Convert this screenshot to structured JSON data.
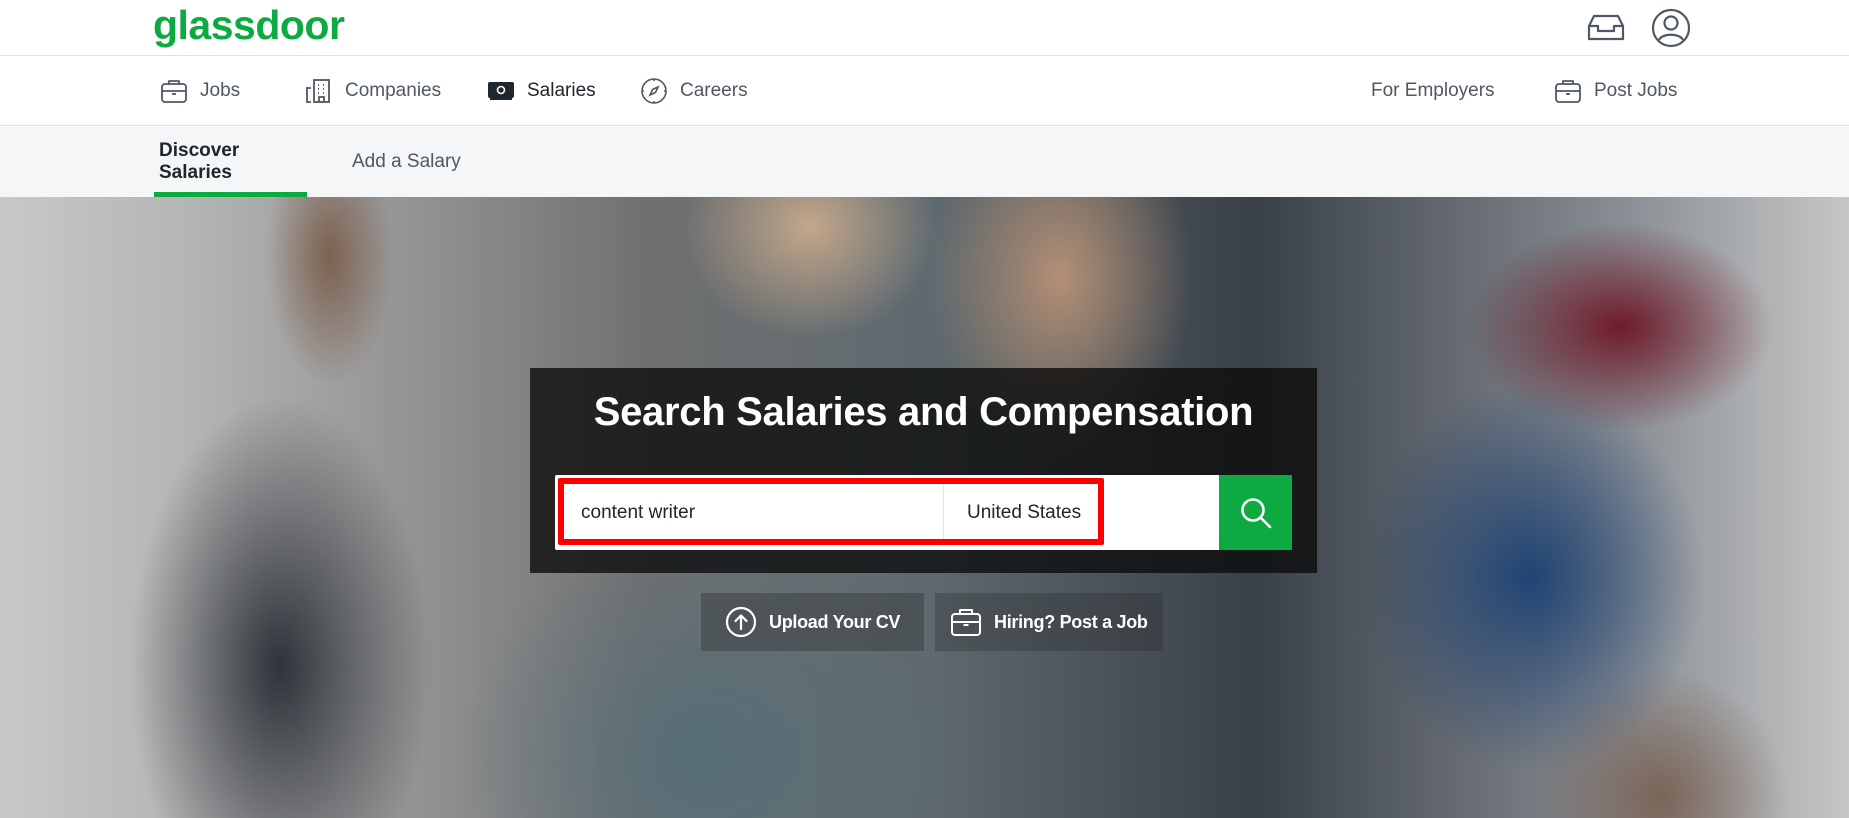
{
  "brand": {
    "logo_text": "glassdoor",
    "accent_color": "#0caa41"
  },
  "header": {
    "icons": [
      {
        "name": "inbox-icon"
      },
      {
        "name": "profile-icon"
      }
    ]
  },
  "nav": {
    "items": [
      {
        "label": "Jobs",
        "icon": "briefcase-icon",
        "active": false
      },
      {
        "label": "Companies",
        "icon": "building-icon",
        "active": false
      },
      {
        "label": "Salaries",
        "icon": "money-icon",
        "active": true
      },
      {
        "label": "Careers",
        "icon": "compass-icon",
        "active": false
      }
    ],
    "right_items": [
      {
        "label": "For Employers"
      },
      {
        "label": "Post Jobs",
        "icon": "briefcase-icon"
      }
    ]
  },
  "subnav": {
    "tabs": [
      {
        "label": "Discover Salaries",
        "active": true
      },
      {
        "label": "Add a Salary",
        "active": false
      }
    ]
  },
  "hero": {
    "title": "Search Salaries and Compensation",
    "job_input": {
      "value": "content writer"
    },
    "location_input": {
      "value": "United States"
    },
    "search_button_icon": "search-icon",
    "highlight_color": "#ff0000",
    "ctas": [
      {
        "label": "Upload Your CV",
        "icon": "upload-circle-icon"
      },
      {
        "label": "Hiring? Post a Job",
        "icon": "briefcase-icon"
      }
    ]
  }
}
